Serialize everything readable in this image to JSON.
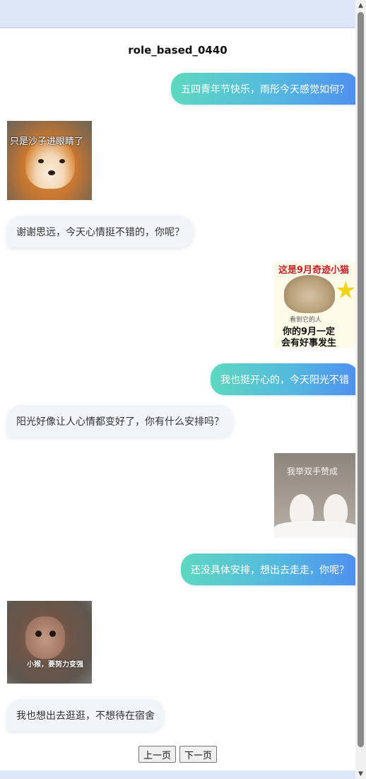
{
  "title": "role_based_0440",
  "messages": {
    "m1": "五四青年节快乐，雨彤今天感觉如何？",
    "m3": "谢谢思远，今天心情挺不错的，你呢？",
    "m5": "我也挺开心的，今天阳光不错",
    "m6": "阳光好像让人心情都变好了，你有什么安排吗？",
    "m8": "还没具体安排，想出去走走，你呢？",
    "m10": "我也想出去逛逛，不想待在宿舍"
  },
  "stickers": {
    "s1": {
      "caption": "只是沙子进眼睛了"
    },
    "s2": {
      "caption_top": "这是9月奇迹小猫",
      "caption_small": "看到它的人",
      "caption_line1": "你的9月一定",
      "caption_line2": "会有好事发生"
    },
    "s3": {
      "caption": "我举双手赞成"
    },
    "s4": {
      "caption": "小猴，要努力变强"
    }
  },
  "pager": {
    "prev": "上一页",
    "next": "下一页"
  }
}
